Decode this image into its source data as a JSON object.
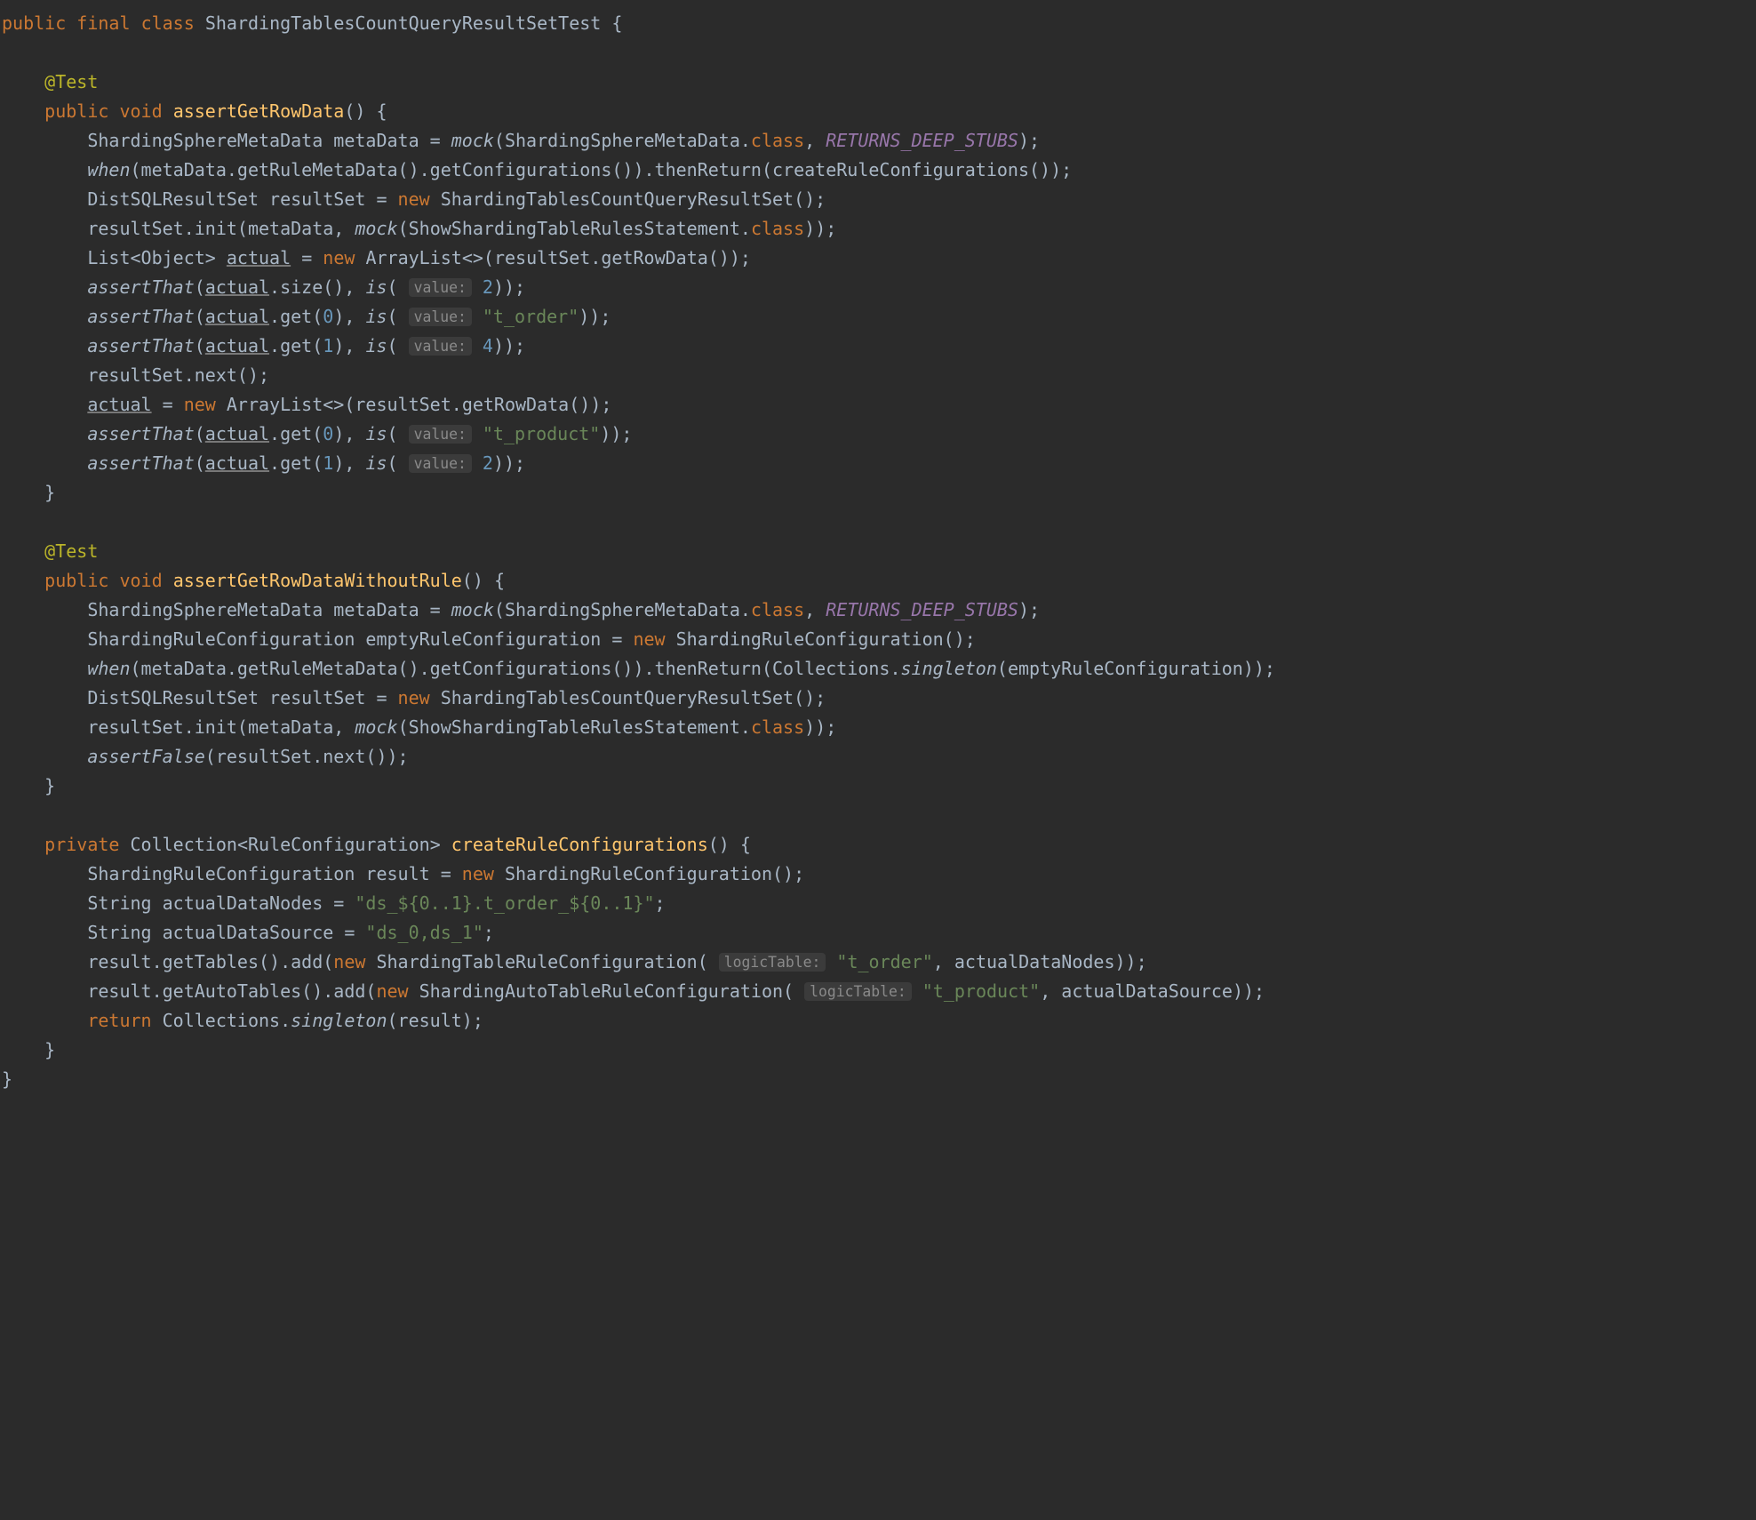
{
  "class_decl": {
    "public": "public",
    "final": "final",
    "class": "class",
    "name": "ShardingTablesCountQueryResultSetTest"
  },
  "m1": {
    "ann": "@Test",
    "public": "public",
    "void": "void",
    "name": "assertGetRowData",
    "l1": {
      "type": "ShardingSphereMetaData",
      "var": "metaData",
      "mock": "mock",
      "arg_type": "ShardingSphereMetaData",
      "class_kw": "class",
      "ret": "RETURNS_DEEP_STUBS"
    },
    "l2": {
      "when": "when",
      "v1": "metaData",
      "m1": "getRuleMetaData",
      "m2": "getConfigurations",
      "then": "thenReturn",
      "call": "createRuleConfigurations"
    },
    "l3": {
      "type": "DistSQLResultSet",
      "var": "resultSet",
      "new": "new",
      "ctor": "ShardingTablesCountQueryResultSet"
    },
    "l4": {
      "v": "resultSet",
      "m": "init",
      "arg1": "metaData",
      "mock": "mock",
      "arg_type": "ShowShardingTableRulesStatement",
      "class_kw": "class"
    },
    "l5": {
      "type1": "List",
      "gen": "Object",
      "var": "actual",
      "new": "new",
      "ctor": "ArrayList",
      "rs": "resultSet",
      "m": "getRowData"
    },
    "l6": {
      "assert": "assertThat",
      "v": "actual",
      "m": "size",
      "is": "is",
      "hint": "value:",
      "val": "2"
    },
    "l7": {
      "assert": "assertThat",
      "v": "actual",
      "m": "get",
      "idx": "0",
      "is": "is",
      "hint": "value:",
      "val": "\"t_order\""
    },
    "l8": {
      "assert": "assertThat",
      "v": "actual",
      "m": "get",
      "idx": "1",
      "is": "is",
      "hint": "value:",
      "val": "4"
    },
    "l9": {
      "v": "resultSet",
      "m": "next"
    },
    "l10": {
      "var": "actual",
      "new": "new",
      "ctor": "ArrayList",
      "rs": "resultSet",
      "m": "getRowData"
    },
    "l11": {
      "assert": "assertThat",
      "v": "actual",
      "m": "get",
      "idx": "0",
      "is": "is",
      "hint": "value:",
      "val": "\"t_product\""
    },
    "l12": {
      "assert": "assertThat",
      "v": "actual",
      "m": "get",
      "idx": "1",
      "is": "is",
      "hint": "value:",
      "val": "2"
    }
  },
  "m2": {
    "ann": "@Test",
    "public": "public",
    "void": "void",
    "name": "assertGetRowDataWithoutRule",
    "l1": {
      "type": "ShardingSphereMetaData",
      "var": "metaData",
      "mock": "mock",
      "arg_type": "ShardingSphereMetaData",
      "class_kw": "class",
      "ret": "RETURNS_DEEP_STUBS"
    },
    "l2": {
      "type": "ShardingRuleConfiguration",
      "var": "emptyRuleConfiguration",
      "new": "new",
      "ctor": "ShardingRuleConfiguration"
    },
    "l3": {
      "when": "when",
      "v1": "metaData",
      "m1": "getRuleMetaData",
      "m2": "getConfigurations",
      "then": "thenReturn",
      "coll": "Collections",
      "sing": "singleton",
      "arg": "emptyRuleConfiguration"
    },
    "l4": {
      "type": "DistSQLResultSet",
      "var": "resultSet",
      "new": "new",
      "ctor": "ShardingTablesCountQueryResultSet"
    },
    "l5": {
      "v": "resultSet",
      "m": "init",
      "arg1": "metaData",
      "mock": "mock",
      "arg_type": "ShowShardingTableRulesStatement",
      "class_kw": "class"
    },
    "l6": {
      "assert": "assertFalse",
      "v": "resultSet",
      "m": "next"
    }
  },
  "m3": {
    "private": "private",
    "ret_type": "Collection",
    "gen": "RuleConfiguration",
    "name": "createRuleConfigurations",
    "l1": {
      "type": "ShardingRuleConfiguration",
      "var": "result",
      "new": "new",
      "ctor": "ShardingRuleConfiguration"
    },
    "l2": {
      "type": "String",
      "var": "actualDataNodes",
      "val": "\"ds_${0..1}.t_order_${0..1}\""
    },
    "l3": {
      "type": "String",
      "var": "actualDataSource",
      "val": "\"ds_0,ds_1\""
    },
    "l4": {
      "v": "result",
      "m1": "getTables",
      "m2": "add",
      "new": "new",
      "ctor": "ShardingTableRuleConfiguration",
      "hint": "logicTable:",
      "s": "\"t_order\"",
      "arg2": "actualDataNodes"
    },
    "l5": {
      "v": "result",
      "m1": "getAutoTables",
      "m2": "add",
      "new": "new",
      "ctor": "ShardingAutoTableRuleConfiguration",
      "hint": "logicTable:",
      "s": "\"t_product\"",
      "arg2": "actualDataSource"
    },
    "l6": {
      "return": "return",
      "coll": "Collections",
      "sing": "singleton",
      "arg": "result"
    }
  }
}
